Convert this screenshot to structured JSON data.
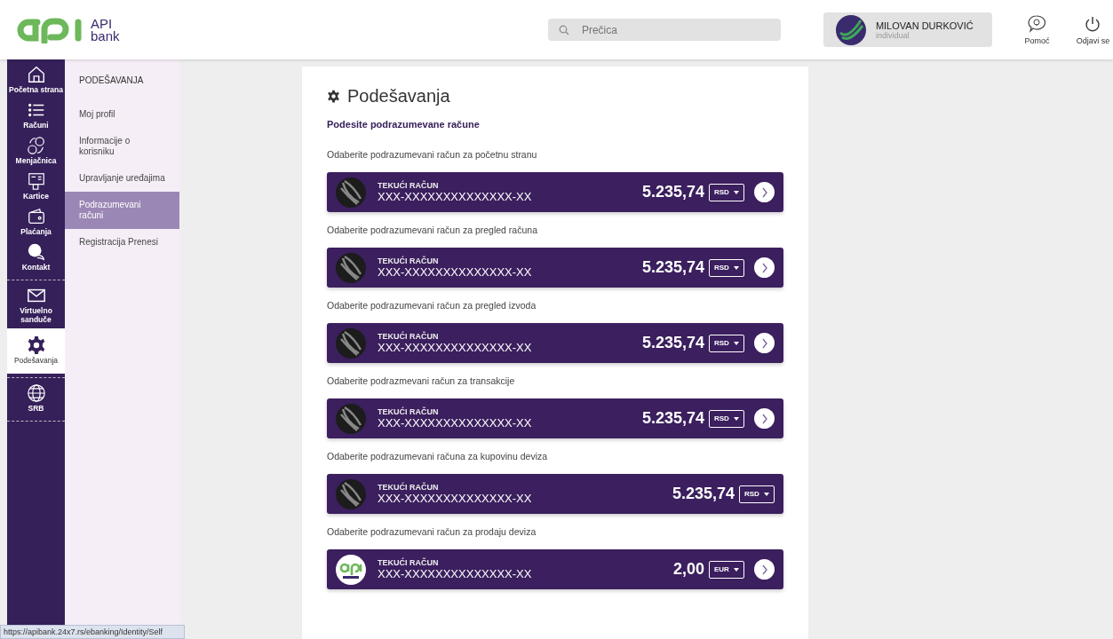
{
  "header": {
    "logo_text": [
      "API",
      "bank"
    ],
    "search": {
      "placeholder": "Prečica"
    },
    "user": {
      "name": "MILOVAN DURKOVIĆ",
      "type": "individual"
    },
    "actions": [
      {
        "label": "Pomoć"
      },
      {
        "label": "Odjavi se"
      }
    ]
  },
  "rail_groups": [
    {
      "items": [
        {
          "label": "Početna strana",
          "selected": false
        },
        {
          "label": "Računi",
          "selected": false
        },
        {
          "label": "Menjačnica",
          "selected": false
        },
        {
          "label": "Kartice",
          "selected": false
        },
        {
          "label": "Plaćanja",
          "selected": false
        },
        {
          "label": "Kontakt",
          "selected": false
        }
      ]
    },
    {
      "items": [
        {
          "label": "Virtuelno sanduče",
          "selected": false
        },
        {
          "label": "Podešavanja",
          "selected": true
        }
      ]
    },
    {
      "items": [
        {
          "label": "SRB",
          "selected": false
        }
      ]
    }
  ],
  "submenu": {
    "title": "PODEŠAVANJA",
    "items": [
      {
        "label": "Moj profil",
        "selected": false
      },
      {
        "label": "Informacije o korisniku",
        "selected": false
      },
      {
        "label": "Upravljanje uređajima",
        "selected": false
      },
      {
        "label": "Podrazumevani računi",
        "selected": true
      },
      {
        "label": "Registracija Prenesi",
        "selected": false
      }
    ]
  },
  "page": {
    "title": "Podešavanja",
    "subtitle": "Podesite podrazumevane račune",
    "sections": [
      {
        "label": "Odaberite podrazumevani račun za početnu stranu",
        "account": {
          "kind": "dark",
          "type": "TEKUĆI RAČUN",
          "number": "XXX-XXXXXXXXXXXXXX-XX",
          "amount": "5.235,74",
          "currency": "RSD",
          "arrow": true
        }
      },
      {
        "label": "Odaberite podrazumevani račun za pregled računa",
        "account": {
          "kind": "dark",
          "type": "TEKUĆI RAČUN",
          "number": "XXX-XXXXXXXXXXXXXX-XX",
          "amount": "5.235,74",
          "currency": "RSD",
          "arrow": true
        }
      },
      {
        "label": "Odaberite podrazumevani račun za pregled izvoda",
        "account": {
          "kind": "dark",
          "type": "TEKUĆI RAČUN",
          "number": "XXX-XXXXXXXXXXXXXX-XX",
          "amount": "5.235,74",
          "currency": "RSD",
          "arrow": true
        }
      },
      {
        "label": "Odaberite podrazmevani račun za transakcije",
        "account": {
          "kind": "dark",
          "type": "TEKUĆI RAČUN",
          "number": "XXX-XXXXXXXXXXXXXX-XX",
          "amount": "5.235,74",
          "currency": "RSD",
          "arrow": true
        }
      },
      {
        "label": "Odaberite podrazumevani računa za kupovinu deviza",
        "account": {
          "kind": "dark",
          "type": "TEKUĆI RAČUN",
          "number": "XXX-XXXXXXXXXXXXXX-XX",
          "amount": "5.235,74",
          "currency": "RSD",
          "arrow": false
        }
      },
      {
        "label": "Odaberite podrazumevani račun za prodaju deviza",
        "account": {
          "kind": "api",
          "type": "TEKUĆI RAČUN",
          "number": "XXX-XXXXXXXXXXXXXX-XX",
          "amount": "2,00",
          "currency": "EUR",
          "arrow": true
        }
      }
    ]
  },
  "status_url": "https://apibank.24x7.rs/ebanking/Identity/Self"
}
